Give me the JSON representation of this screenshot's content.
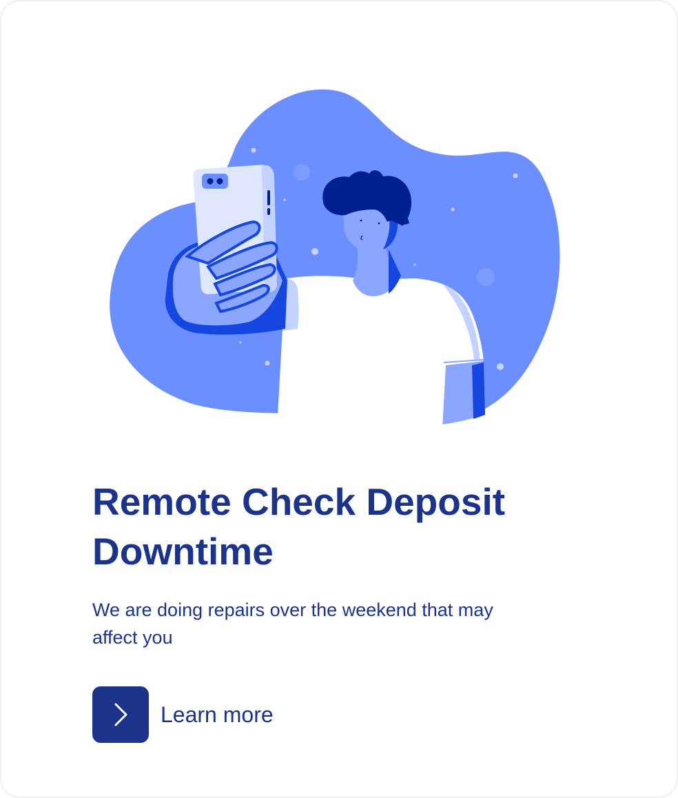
{
  "card": {
    "title_line_1": "Remote Check Deposit",
    "title_line_2": "Downtime",
    "subtitle_line_1": "We are doing repairs over the weekend that may",
    "subtitle_line_2": "affect you",
    "learn_more_label": "Learn more",
    "learn_more_icon": "chevron-right-icon"
  },
  "illustration": {
    "description_icon": "person-taking-selfie-illustration"
  },
  "colors": {
    "primary_navy": "#1b3389",
    "blob_blue": "#6b8ffe",
    "accent_blue": "#1547e0",
    "light_blue": "#8aa6ff",
    "dark_navy": "#01208f",
    "phone_body": "#dfe7ff"
  }
}
